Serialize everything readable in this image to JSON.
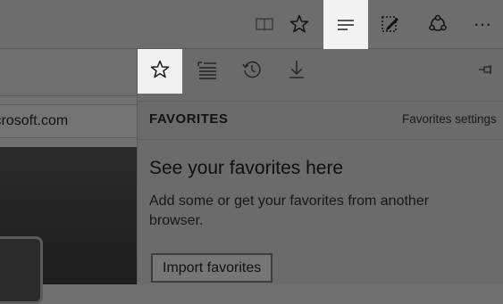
{
  "toolbar": {
    "icons": [
      "reading-view-icon",
      "favorite-star-icon",
      "hub-icon",
      "web-note-icon",
      "share-icon",
      "more-icon"
    ],
    "more_label": "⋯"
  },
  "page": {
    "address_text": "icrosoft.com"
  },
  "hub": {
    "tabs": [
      "favorites-tab",
      "reading-list-tab",
      "history-tab",
      "downloads-tab"
    ],
    "title": "FAVORITES",
    "settings_link": "Favorites settings",
    "empty_heading": "See your favorites here",
    "empty_description": "Add some or get your favorites from another browser.",
    "import_button": "Import favorites"
  },
  "colors": {
    "active_highlight": "#f3f3f3",
    "dimmed_background": "#6d6d6d"
  }
}
